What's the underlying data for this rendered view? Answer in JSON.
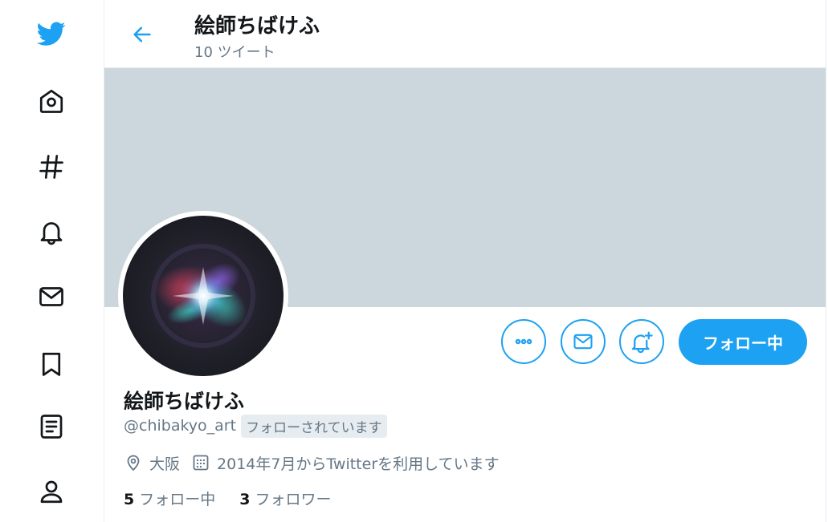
{
  "colors": {
    "accent": "#1da1f2",
    "banner": "#ccd6dd",
    "muted_text": "#657786",
    "main_text": "#14171a",
    "border": "#e6ecf0"
  },
  "nav": {
    "items": [
      {
        "name": "twitter-logo",
        "icon": "bird-icon"
      },
      {
        "name": "home",
        "icon": "home-icon"
      },
      {
        "name": "explore",
        "icon": "hashtag-icon"
      },
      {
        "name": "notifications",
        "icon": "bell-icon"
      },
      {
        "name": "messages",
        "icon": "envelope-icon"
      },
      {
        "name": "bookmarks",
        "icon": "bookmark-icon"
      },
      {
        "name": "lists",
        "icon": "list-icon"
      },
      {
        "name": "profile",
        "icon": "person-icon"
      }
    ]
  },
  "header": {
    "title": "絵師ちばけふ",
    "tweet_count": "10 ツイート",
    "back_icon": "back-arrow-icon"
  },
  "profile": {
    "display_name": "絵師ちばけふ",
    "handle": "@chibakyo_art",
    "follows_you_badge": "フォローされています",
    "location": "大阪",
    "joined": "2014年7月からTwitterを利用しています",
    "following_count": "5",
    "following_label": "フォロー中",
    "followers_count": "3",
    "followers_label": "フォロワー"
  },
  "actions": {
    "more_icon": "more-icon",
    "message_icon": "envelope-icon",
    "notify_icon": "bell-plus-icon",
    "follow_button_label": "フォロー中"
  }
}
